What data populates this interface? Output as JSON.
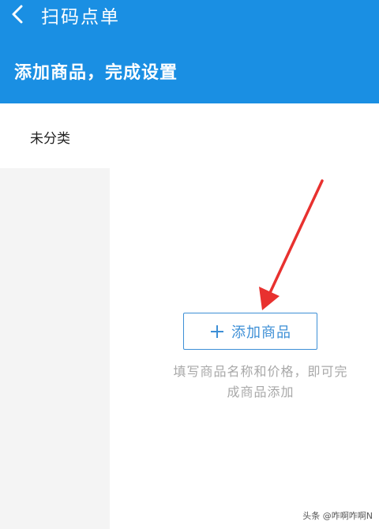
{
  "header": {
    "nav_title": "扫码点单",
    "heading": "添加商品，完成设置",
    "accent_color": "#1a8fe3",
    "back_icon": "chevron-left-icon"
  },
  "sidebar": {
    "categories": [
      {
        "label": "未分类",
        "selected": true
      }
    ]
  },
  "main": {
    "add_button_label": "添加商品",
    "add_button_icon": "plus-icon",
    "hint_line1": "填写商品名称和价格，即可完",
    "hint_line2": "成商品添加"
  },
  "annotation": {
    "arrow_color": "#e8312f"
  },
  "watermark": {
    "text": "头条 @咋啊咋啊N"
  }
}
